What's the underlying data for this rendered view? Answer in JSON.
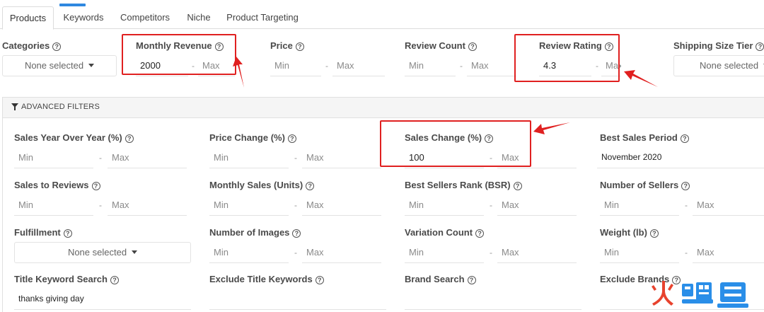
{
  "tabs": [
    {
      "label": "Products",
      "active": true
    },
    {
      "label": "Keywords",
      "active": false
    },
    {
      "label": "Competitors",
      "active": false
    },
    {
      "label": "Niche",
      "active": false
    },
    {
      "label": "Product Targeting",
      "active": false
    }
  ],
  "help_glyph": "?",
  "top_filters": {
    "categories": {
      "label": "Categories",
      "value": "None selected"
    },
    "monthly_revenue": {
      "label": "Monthly Revenue",
      "min": "2000",
      "max_placeholder": "Max"
    },
    "price": {
      "label": "Price",
      "min_placeholder": "Min",
      "max_placeholder": "Max"
    },
    "review_count": {
      "label": "Review Count",
      "min_placeholder": "Min",
      "max_placeholder": "Max"
    },
    "review_rating": {
      "label": "Review Rating",
      "min": "4.3",
      "max_placeholder": "Max"
    },
    "shipping_size_tier": {
      "label": "Shipping Size Tier",
      "value": "None selected"
    }
  },
  "advanced": {
    "title": "ADVANCED FILTERS",
    "sales_yoy": {
      "label": "Sales Year Over Year (%)",
      "min_placeholder": "Min",
      "max_placeholder": "Max"
    },
    "price_change": {
      "label": "Price Change (%)",
      "min_placeholder": "Min",
      "max_placeholder": "Max"
    },
    "sales_change": {
      "label": "Sales Change (%)",
      "min": "100",
      "max_placeholder": "Max"
    },
    "best_sales_period": {
      "label": "Best Sales Period",
      "value": "November 2020"
    },
    "sales_to_reviews": {
      "label": "Sales to Reviews",
      "min_placeholder": "Min",
      "max_placeholder": "Max"
    },
    "monthly_sales": {
      "label": "Monthly Sales (Units)",
      "min_placeholder": "Min",
      "max_placeholder": "Max"
    },
    "bsr": {
      "label": "Best Sellers Rank (BSR)",
      "min_placeholder": "Min",
      "max_placeholder": "Max"
    },
    "number_of_sellers": {
      "label": "Number of Sellers",
      "min_placeholder": "Min",
      "max_placeholder": "Max"
    },
    "fulfillment": {
      "label": "Fulfillment",
      "value": "None selected"
    },
    "number_of_images": {
      "label": "Number of Images",
      "min_placeholder": "Min",
      "max_placeholder": "Max"
    },
    "variation_count": {
      "label": "Variation Count",
      "min_placeholder": "Min",
      "max_placeholder": "Max"
    },
    "weight": {
      "label": "Weight (lb)",
      "min_placeholder": "Min",
      "max_placeholder": "Max"
    },
    "title_keyword_search": {
      "label": "Title Keyword Search",
      "value": "thanks giving day"
    },
    "exclude_title_keywords": {
      "label": "Exclude Title Keywords"
    },
    "brand_search": {
      "label": "Brand Search"
    },
    "exclude_brands": {
      "label": "Exclude Brands"
    }
  },
  "dash": "-",
  "watermark": {
    "text": "火鲤鱼"
  },
  "colors": {
    "accent": "#2f88e0",
    "annotation": "#e02020",
    "watermark_red": "#e8432e",
    "watermark_blue": "#2a8ee8"
  }
}
